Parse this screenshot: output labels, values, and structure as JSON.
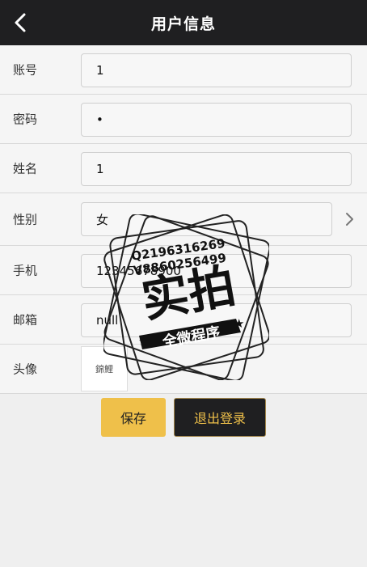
{
  "header": {
    "title": "用户信息",
    "back_icon": "chevron-left-icon"
  },
  "form": {
    "account_label": "账号",
    "account_value": "1",
    "password_label": "密码",
    "password_value": "•",
    "name_label": "姓名",
    "name_value": "1",
    "gender_label": "性别",
    "gender_value": "女",
    "phone_label": "手机",
    "phone_value": "12345678900",
    "email_label": "邮箱",
    "email_value": "null",
    "avatar_label": "头像",
    "avatar_text": "錦鯉"
  },
  "buttons": {
    "save_label": "保存",
    "logout_label": "退出登录"
  },
  "watermark": {
    "line1": "Q2196316269",
    "line2": "V8860256499",
    "main": "实拍",
    "banner": "全微程序"
  },
  "colors": {
    "header_bg": "#1f1f21",
    "accent": "#efc04a"
  }
}
